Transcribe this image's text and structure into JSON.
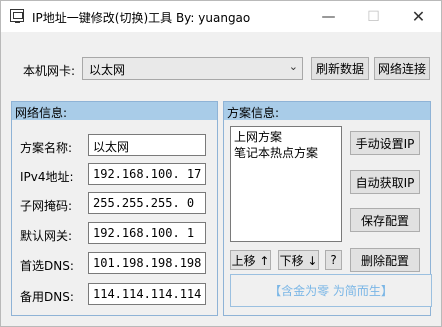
{
  "titlebar": {
    "title": "IP地址一键修改(切换)工具  By: yuangao",
    "minimize": "—",
    "maximize": "☐",
    "close": "✕"
  },
  "nic": {
    "label": "本机网卡:",
    "selected": "以太网",
    "refresh_button": "刷新数据",
    "connections_button": "网络连接"
  },
  "network_info": {
    "header": "网络信息:",
    "fields": [
      {
        "label": "方案名称:",
        "value": "以太网"
      },
      {
        "label": "IPv4地址:",
        "value": "192.168.100. 17"
      },
      {
        "label": "子网掩码:",
        "value": "255.255.255. 0"
      },
      {
        "label": "默认网关:",
        "value": "192.168.100. 1"
      },
      {
        "label": "首选DNS:",
        "value": "101.198.198.198"
      },
      {
        "label": "备用DNS:",
        "value": "114.114.114.114"
      }
    ]
  },
  "scheme_info": {
    "header": "方案信息:",
    "items": [
      "上网方案",
      "笔记本热点方案"
    ],
    "move_up": "上移 ↑",
    "move_down": "下移 ↓",
    "help": "?",
    "manual_ip": "手动设置IP",
    "auto_ip": "自动获取IP",
    "save_config": "保存配置",
    "delete_config": "删除配置",
    "slogan": "【含金为零 为简而生】"
  }
}
